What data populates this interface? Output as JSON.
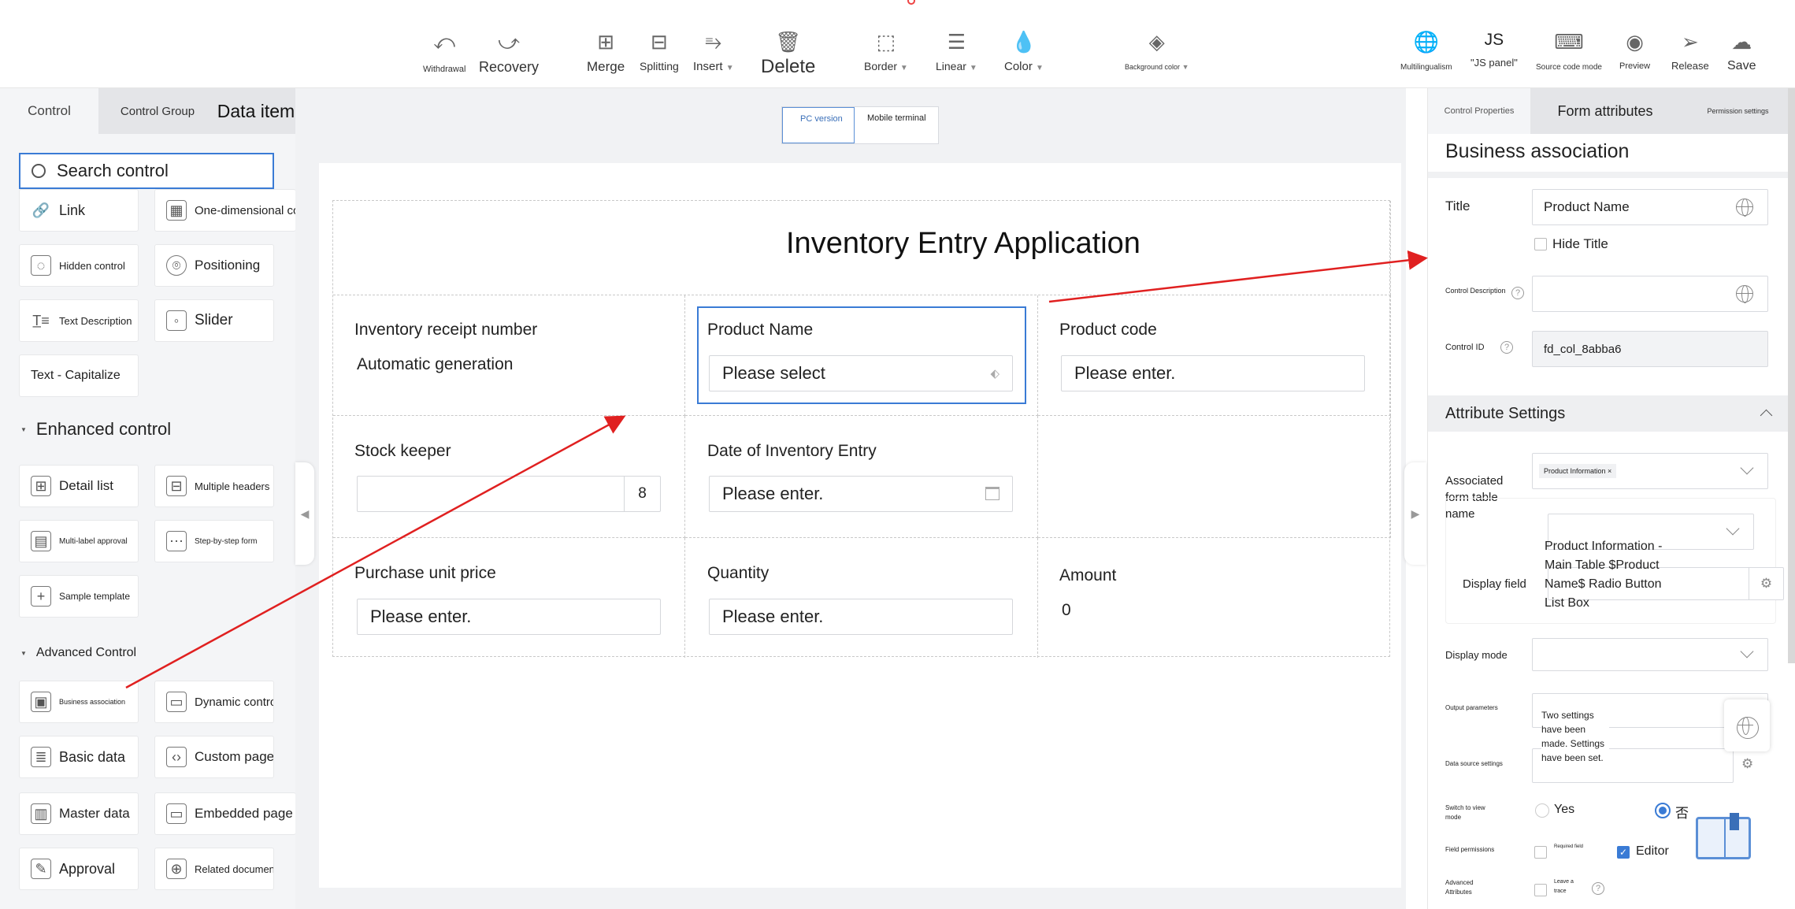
{
  "toolbar": {
    "withdrawal": "Withdrawal",
    "recovery": "Recovery",
    "merge": "Merge",
    "splitting": "Splitting",
    "insert": "Insert",
    "delete": "Delete",
    "border": "Border",
    "linear": "Linear",
    "color": "Color",
    "background_color": "Background color",
    "multilingualism": "Multilingualism",
    "js_icon": "JS",
    "js_panel": "\"JS panel\"",
    "source_code_mode": "Source code mode",
    "preview": "Preview",
    "release": "Release",
    "save": "Save"
  },
  "left": {
    "tabs": [
      "Control",
      "Control Group",
      "Data item"
    ],
    "search_placeholder": "Search control",
    "basic_controls": [
      {
        "label": "Link",
        "icon": "link-icon"
      },
      {
        "label": "One-dimensional code",
        "icon": "qrcode-icon"
      },
      {
        "label": "Hidden control",
        "icon": "hidden-control-icon"
      },
      {
        "label": "Positioning",
        "icon": "location-icon"
      },
      {
        "label": "Text Description",
        "icon": "text-description-icon"
      },
      {
        "label": "Slider",
        "icon": "slider-icon"
      },
      {
        "label": "Text - Capitalize",
        "icon": ""
      }
    ],
    "enhanced_title": "Enhanced control",
    "enhanced_controls": [
      {
        "label": "Detail list",
        "icon": "table-icon"
      },
      {
        "label": "Multiple headers",
        "icon": "multi-header-icon"
      },
      {
        "label": "Multi-label approval",
        "icon": "approval-icon"
      },
      {
        "label": "Step-by-step form",
        "icon": "steps-icon"
      },
      {
        "label": "Sample template",
        "icon": "template-icon"
      }
    ],
    "advanced_title": "Advanced Control",
    "advanced_controls": [
      {
        "label": "Business association",
        "icon": "business-icon"
      },
      {
        "label": "Dynamic control",
        "icon": "dynamic-icon"
      },
      {
        "label": "Basic data",
        "icon": "database-icon"
      },
      {
        "label": "Custom page",
        "icon": "code-icon"
      },
      {
        "label": "Master data",
        "icon": "master-data-icon"
      },
      {
        "label": "Embedded page",
        "icon": "embedded-icon"
      },
      {
        "label": "Approval",
        "icon": "approval-stamp-icon"
      },
      {
        "label": "Related document",
        "icon": "related-doc-icon"
      }
    ]
  },
  "center": {
    "view_tabs": [
      "PC version",
      "Mobile terminal"
    ],
    "form_title": "Inventory Entry Application",
    "receipt_label": "Inventory receipt number",
    "receipt_value": "Automatic generation",
    "product_name_label": "Product Name",
    "product_name_placeholder": "Please select",
    "product_code_label": "Product code",
    "product_code_placeholder": "Please enter.",
    "stock_keeper_label": "Stock keeper",
    "stock_keeper_count": "8",
    "entry_date_label": "Date of Inventory Entry",
    "entry_date_placeholder": "Please enter.",
    "unit_price_label": "Purchase unit price",
    "unit_price_placeholder": "Please enter.",
    "quantity_label": "Quantity",
    "quantity_placeholder": "Please enter.",
    "amount_label": "Amount",
    "amount_value": "0"
  },
  "right": {
    "tabs": [
      "Control Properties",
      "Form attributes",
      "Permission settings"
    ],
    "heading": "Business association",
    "title_label": "Title",
    "title_value": "Product Name",
    "hide_title": "Hide Title",
    "control_description_label": "Control Description",
    "control_id_label": "Control ID",
    "control_id_value": "fd_col_8abba6",
    "attribute_settings": "Attribute Settings",
    "associated_label": "Associated form table name",
    "associated_tag": "Product Information ×",
    "display_field_label": "Display field",
    "display_field_value": "Product Information - Main Table $Product Name$ Radio Button List Box",
    "display_mode_label": "Display mode",
    "output_parameters_label": "Output parameters",
    "output_value": "Two settings have been made. Settings have been set.",
    "data_source_label": "Data source settings",
    "switch_view_label": "Switch to view mode",
    "switch_yes": "Yes",
    "switch_no": "否",
    "field_permissions_label": "Field permissions",
    "required_field": "Required field",
    "editor": "Editor",
    "advanced_attributes_label": "Advanced Attributes",
    "leave_trace": "Leave a trace"
  },
  "colors": {
    "accent": "#3a7bd5",
    "annotation_arrow": "#e02020",
    "panel_bg": "#f4f5f7"
  }
}
